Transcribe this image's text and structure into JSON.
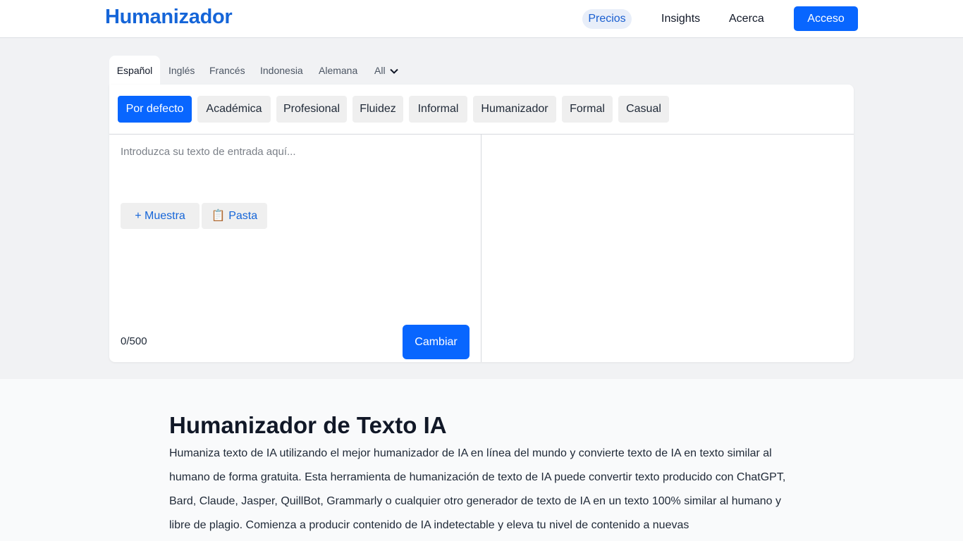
{
  "header": {
    "logo": "Humanizador",
    "nav": [
      {
        "label": "Precios"
      },
      {
        "label": "Insights"
      },
      {
        "label": "Acerca"
      }
    ],
    "login_label": "Acceso"
  },
  "languages": {
    "tabs": [
      "Español",
      "Inglés",
      "Francés",
      "Indonesia",
      "Alemana"
    ],
    "active": "Español",
    "more_label": "All"
  },
  "modes": {
    "items": [
      "Por defecto",
      "Académica",
      "Profesional",
      "Fluidez",
      "Informal",
      "Humanizador",
      "Formal",
      "Casual"
    ],
    "active": "Por defecto"
  },
  "editor": {
    "placeholder": "Introduzca su texto de entrada aquí...",
    "sample_label": "+ Muestra",
    "paste_label": "📋 Pasta",
    "counter": "0/500",
    "submit_label": "Cambiar"
  },
  "article": {
    "title": "Humanizador de Texto IA",
    "body": "Humaniza texto de IA utilizando el mejor humanizador de IA en línea del mundo y convierte texto de IA en texto similar al humano de forma gratuita. Esta herramienta de humanización de texto de IA puede convertir texto producido con ChatGPT, Bard, Claude, Jasper, QuillBot, Grammarly o cualquier otro generador de texto de IA en un texto 100% similar al humano y libre de plagio. Comienza a producir contenido de IA indetectable y eleva tu nivel de contenido a nuevas"
  },
  "colors": {
    "accent": "#0866ff",
    "logo": "#1565d8",
    "background": "#f1f2f4"
  }
}
